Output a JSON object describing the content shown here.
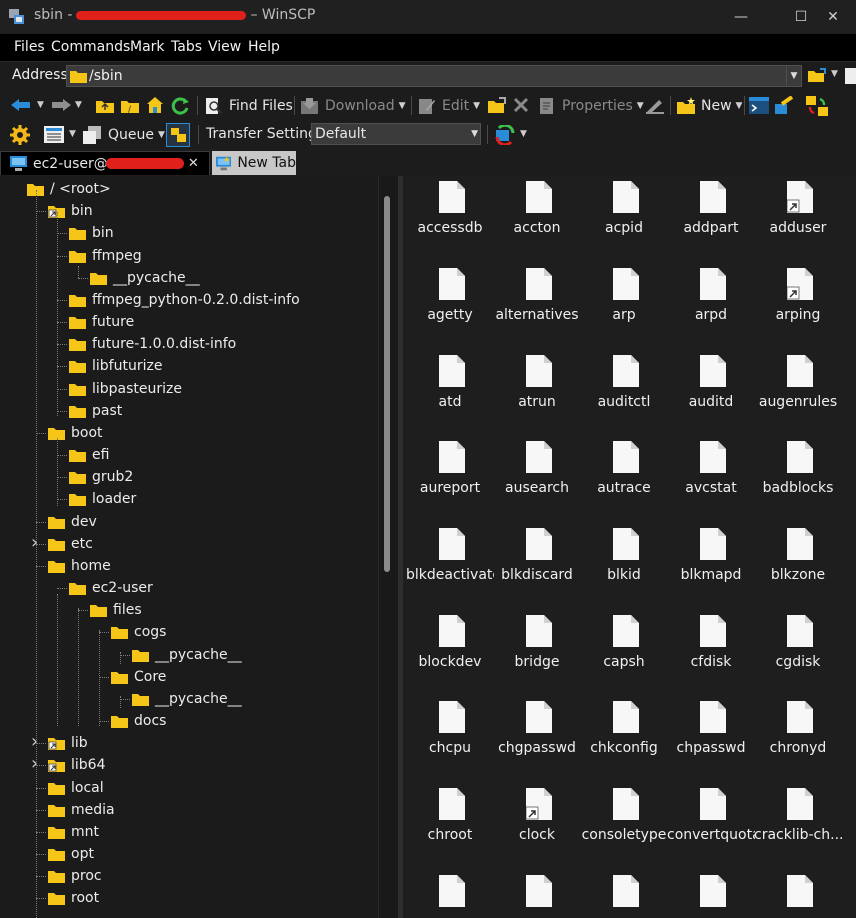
{
  "window": {
    "title_prefix": "sbin -",
    "title_suffix": "– WinSCP",
    "controls": [
      "—",
      "☐",
      "✕"
    ]
  },
  "menu": [
    "Files",
    "Commands",
    "Mark",
    "Tabs",
    "View",
    "Help"
  ],
  "address": {
    "label": "Address",
    "value": "/sbin"
  },
  "toolbar1": {
    "find_files": "Find Files",
    "download": "Download",
    "edit": "Edit",
    "properties": "Properties",
    "new": "New"
  },
  "toolbar2": {
    "queue": "Queue",
    "transfer_settings_label": "Transfer Settings",
    "transfer_settings_value": "Default"
  },
  "tabs": {
    "active": "ec2-user@",
    "new_tab": "New Tab"
  },
  "tree": [
    {
      "label": "/ <root>"
    },
    {
      "label": "bin"
    },
    {
      "label": "bin"
    },
    {
      "label": "ffmpeg"
    },
    {
      "label": "__pycache__"
    },
    {
      "label": "ffmpeg_python-0.2.0.dist-info"
    },
    {
      "label": "future"
    },
    {
      "label": "future-1.0.0.dist-info"
    },
    {
      "label": "libfuturize"
    },
    {
      "label": "libpasteurize"
    },
    {
      "label": "past"
    },
    {
      "label": "boot"
    },
    {
      "label": "efi"
    },
    {
      "label": "grub2"
    },
    {
      "label": "loader"
    },
    {
      "label": "dev"
    },
    {
      "label": "etc"
    },
    {
      "label": "home"
    },
    {
      "label": "ec2-user"
    },
    {
      "label": "files"
    },
    {
      "label": "cogs"
    },
    {
      "label": "__pycache__"
    },
    {
      "label": "Core"
    },
    {
      "label": "__pycache__"
    },
    {
      "label": "docs"
    },
    {
      "label": "lib"
    },
    {
      "label": "lib64"
    },
    {
      "label": "local"
    },
    {
      "label": "media"
    },
    {
      "label": "mnt"
    },
    {
      "label": "opt"
    },
    {
      "label": "proc"
    },
    {
      "label": "root"
    }
  ],
  "files": [
    "accessdb",
    "accton",
    "acpid",
    "addpart",
    "adduser",
    "agetty",
    "alternatives",
    "arp",
    "arpd",
    "arping",
    "atd",
    "atrun",
    "auditctl",
    "auditd",
    "augenrules",
    "aureport",
    "ausearch",
    "autrace",
    "avcstat",
    "badblocks",
    "blkdeactivate",
    "blkdiscard",
    "blkid",
    "blkmapd",
    "blkzone",
    "blockdev",
    "bridge",
    "capsh",
    "cfdisk",
    "cgdisk",
    "chcpu",
    "chgpasswd",
    "chkconfig",
    "chpasswd",
    "chronyd",
    "chroot",
    "clock",
    "consoletype",
    "convertquota",
    "cracklib-ch...",
    "",
    "",
    "",
    "",
    ""
  ],
  "colors": {
    "folder": "#f5c518",
    "redaction": "#e0201b",
    "accent_blue": "#2a8bd6",
    "refresh_green": "#3cc24a"
  }
}
